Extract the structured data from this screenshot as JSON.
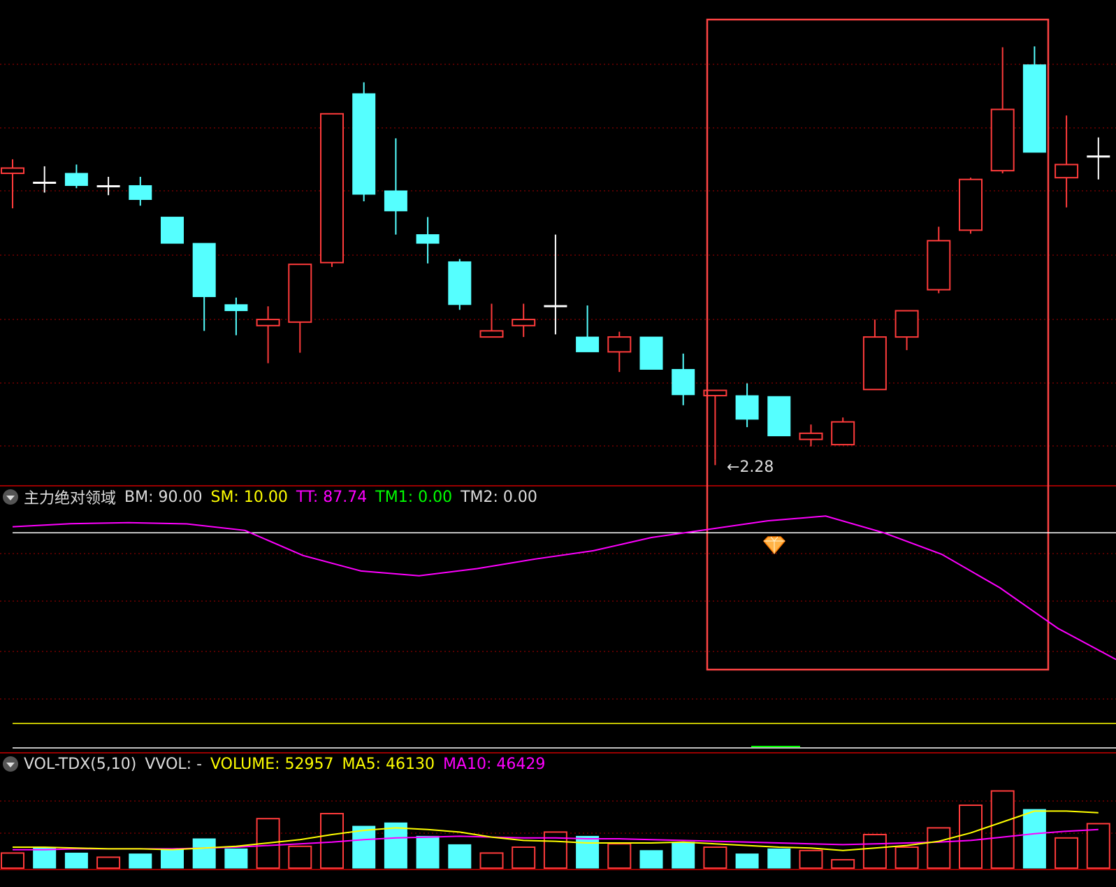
{
  "colors": {
    "up": "#ff3b3b",
    "down": "#55ffff",
    "neutral": "#ffffff",
    "grid": "#aa0000",
    "panel_border": "#cc0000",
    "highlight_box": "#ff4444",
    "tt_line": "#ff00ff",
    "bm_line": "#ffffff",
    "sm_line": "#ffff00",
    "tm1": "#00ff00",
    "ma5": "#ffff00",
    "ma10": "#ff00ff"
  },
  "price_low_label": "2.28",
  "indicator_panel": {
    "title": "主力绝对领域",
    "items": [
      {
        "key": "BM",
        "label": "BM: 90.00",
        "color": "#dddddd"
      },
      {
        "key": "SM",
        "label": "SM: 10.00",
        "color": "#ffff00"
      },
      {
        "key": "TT",
        "label": "TT: 87.74",
        "color": "#ff00ff"
      },
      {
        "key": "TM1",
        "label": "TM1: 0.00",
        "color": "#00ff00"
      },
      {
        "key": "TM2",
        "label": "TM2: 0.00",
        "color": "#dddddd"
      }
    ],
    "icon": "diamond-signal-icon"
  },
  "volume_panel": {
    "title": "VOL-TDX(5,10)",
    "items": [
      {
        "key": "VVOL",
        "label": "VVOL: -",
        "color": "#dddddd"
      },
      {
        "key": "VOLUME",
        "label": "VOLUME: 52957",
        "color": "#ffff00"
      },
      {
        "key": "MA5",
        "label": "MA5: 46130",
        "color": "#ffff00"
      },
      {
        "key": "MA10",
        "label": "MA10: 46429",
        "color": "#ff00ff"
      }
    ]
  },
  "chart_data": {
    "type": "candlestick",
    "grid": true,
    "candles": [
      {
        "o": 2.617,
        "h": 2.633,
        "l": 2.577,
        "c": 2.623
      },
      {
        "o": 2.607,
        "h": 2.625,
        "l": 2.595,
        "c": 2.607
      },
      {
        "o": 2.617,
        "h": 2.627,
        "l": 2.6,
        "c": 2.603
      },
      {
        "o": 2.603,
        "h": 2.613,
        "l": 2.592,
        "c": 2.603
      },
      {
        "o": 2.603,
        "h": 2.613,
        "l": 2.58,
        "c": 2.587
      },
      {
        "o": 2.567,
        "h": 2.567,
        "l": 2.557,
        "c": 2.537
      },
      {
        "o": 2.537,
        "h": 2.537,
        "l": 2.437,
        "c": 2.476
      },
      {
        "o": 2.467,
        "h": 2.475,
        "l": 2.432,
        "c": 2.46
      },
      {
        "o": 2.443,
        "h": 2.465,
        "l": 2.4,
        "c": 2.45
      },
      {
        "o": 2.447,
        "h": 2.503,
        "l": 2.412,
        "c": 2.513
      },
      {
        "o": 2.515,
        "h": 2.515,
        "l": 2.51,
        "c": 2.685
      },
      {
        "o": 2.708,
        "h": 2.721,
        "l": 2.585,
        "c": 2.593
      },
      {
        "o": 2.597,
        "h": 2.657,
        "l": 2.547,
        "c": 2.574
      },
      {
        "o": 2.547,
        "h": 2.567,
        "l": 2.514,
        "c": 2.537
      },
      {
        "o": 2.516,
        "h": 2.519,
        "l": 2.461,
        "c": 2.467
      },
      {
        "o": 2.43,
        "h": 2.468,
        "l": 2.43,
        "c": 2.437
      },
      {
        "o": 2.443,
        "h": 2.468,
        "l": 2.43,
        "c": 2.45
      },
      {
        "o": 2.466,
        "h": 2.547,
        "l": 2.433,
        "c": 2.466
      },
      {
        "o": 2.43,
        "h": 2.466,
        "l": 2.413,
        "c": 2.413
      },
      {
        "o": 2.413,
        "h": 2.436,
        "l": 2.39,
        "c": 2.43
      },
      {
        "o": 2.43,
        "h": 2.43,
        "l": 2.393,
        "c": 2.393
      },
      {
        "o": 2.393,
        "h": 2.411,
        "l": 2.352,
        "c": 2.364
      },
      {
        "o": 2.363,
        "h": 2.363,
        "l": 2.29,
        "c": 2.369
      },
      {
        "o": 2.363,
        "h": 2.377,
        "l": 2.327,
        "c": 2.336
      },
      {
        "o": 2.362,
        "h": 2.362,
        "l": 2.317,
        "c": 2.317
      },
      {
        "o": 2.313,
        "h": 2.33,
        "l": 2.305,
        "c": 2.32
      },
      {
        "o": 2.307,
        "h": 2.338,
        "l": 2.307,
        "c": 2.333
      },
      {
        "o": 2.37,
        "h": 2.45,
        "l": 2.37,
        "c": 2.43
      },
      {
        "o": 2.43,
        "h": 2.443,
        "l": 2.415,
        "c": 2.46
      },
      {
        "o": 2.484,
        "h": 2.556,
        "l": 2.48,
        "c": 2.54
      },
      {
        "o": 2.552,
        "h": 2.612,
        "l": 2.548,
        "c": 2.61
      },
      {
        "o": 2.62,
        "h": 2.761,
        "l": 2.617,
        "c": 2.69
      },
      {
        "o": 2.741,
        "h": 2.762,
        "l": 2.641,
        "c": 2.641
      },
      {
        "o": 2.612,
        "h": 2.683,
        "l": 2.578,
        "c": 2.627
      },
      {
        "o": 2.637,
        "h": 2.658,
        "l": 2.61,
        "c": 2.637
      }
    ],
    "volume": [
      {
        "v": 18000,
        "up": true
      },
      {
        "v": 25000,
        "up": false
      },
      {
        "v": 18000,
        "up": false
      },
      {
        "v": 13000,
        "up": true
      },
      {
        "v": 17000,
        "up": false
      },
      {
        "v": 23000,
        "up": false
      },
      {
        "v": 35000,
        "up": false
      },
      {
        "v": 23000,
        "up": false
      },
      {
        "v": 59000,
        "up": true
      },
      {
        "v": 26000,
        "up": true
      },
      {
        "v": 65000,
        "up": true
      },
      {
        "v": 50000,
        "up": false
      },
      {
        "v": 54000,
        "up": false
      },
      {
        "v": 38000,
        "up": false
      },
      {
        "v": 28000,
        "up": false
      },
      {
        "v": 18000,
        "up": true
      },
      {
        "v": 25000,
        "up": true
      },
      {
        "v": 43000,
        "up": true
      },
      {
        "v": 38000,
        "up": false
      },
      {
        "v": 29000,
        "up": true
      },
      {
        "v": 21000,
        "up": false
      },
      {
        "v": 31000,
        "up": false
      },
      {
        "v": 25000,
        "up": true
      },
      {
        "v": 17000,
        "up": false
      },
      {
        "v": 23000,
        "up": false
      },
      {
        "v": 21000,
        "up": true
      },
      {
        "v": 10000,
        "up": true
      },
      {
        "v": 40000,
        "up": true
      },
      {
        "v": 25000,
        "up": true
      },
      {
        "v": 48000,
        "up": true
      },
      {
        "v": 75000,
        "up": true
      },
      {
        "v": 92000,
        "up": true
      },
      {
        "v": 70000,
        "up": false
      },
      {
        "v": 36000,
        "up": true
      },
      {
        "v": 53000,
        "up": true
      }
    ],
    "ma5": [
      25000,
      25000,
      24000,
      23000,
      23000,
      22000,
      24000,
      26000,
      30000,
      34000,
      40000,
      45000,
      48000,
      46000,
      43000,
      37000,
      33000,
      32000,
      30000,
      30000,
      30000,
      31000,
      29000,
      27000,
      25000,
      24000,
      21000,
      24000,
      27000,
      32000,
      42000,
      55000,
      68000,
      68000,
      66000
    ],
    "ma10": [
      22000,
      22000,
      23000,
      23000,
      23000,
      23000,
      24000,
      25000,
      27000,
      29000,
      31000,
      34000,
      36000,
      37000,
      38000,
      37000,
      36000,
      36000,
      35000,
      35000,
      34000,
      33000,
      32000,
      31000,
      30000,
      29000,
      28000,
      29000,
      30000,
      31000,
      33000,
      37000,
      41000,
      44000,
      46000
    ],
    "tt": [
      92.5,
      93.8,
      94.2,
      93.7,
      91.0,
      80.5,
      74.0,
      72.0,
      75.0,
      79.0,
      82.5,
      88.0,
      91.5,
      95.0,
      97.0,
      90.0,
      81.0,
      67.0,
      50.0,
      37.0
    ],
    "tt_levels": {
      "BM": 90.0,
      "SM": 10.0
    }
  }
}
